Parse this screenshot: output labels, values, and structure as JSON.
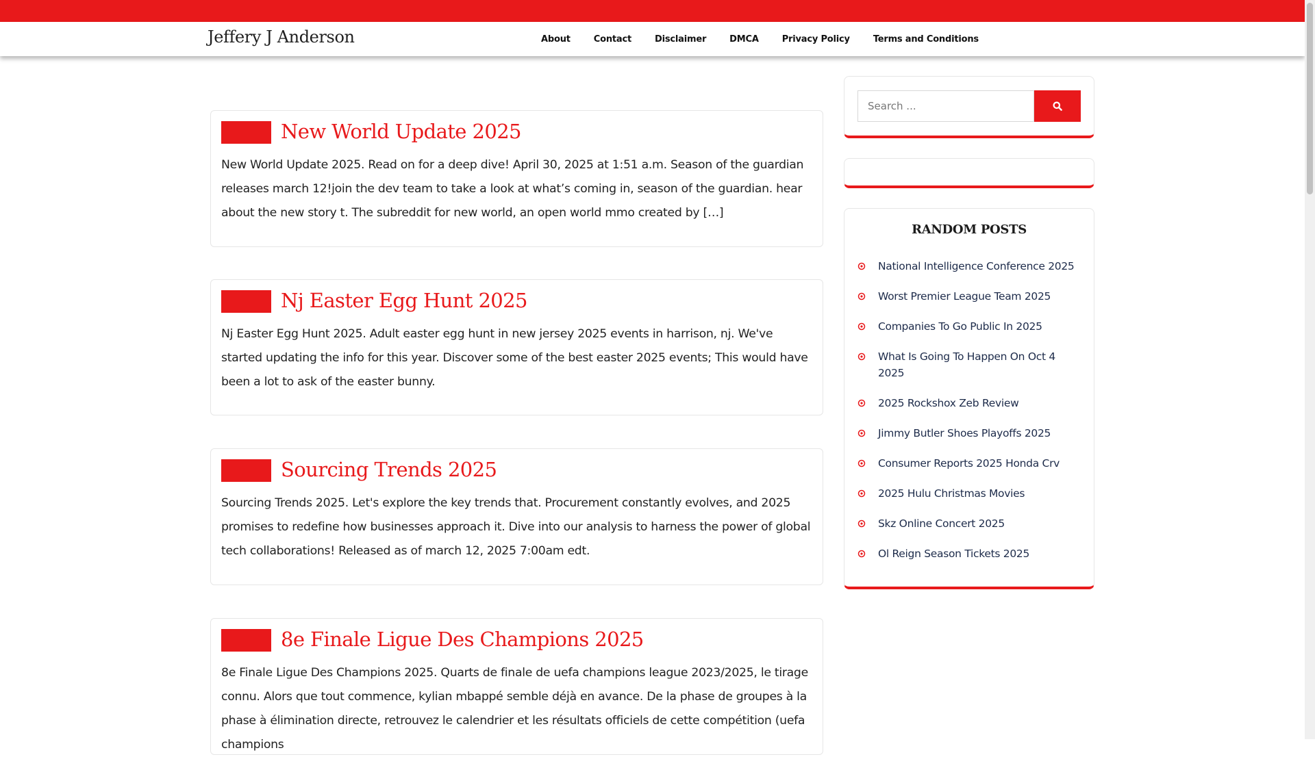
{
  "site": {
    "title": "Jeffery J Anderson"
  },
  "nav": {
    "items": [
      "About",
      "Contact",
      "Disclaimer",
      "DMCA",
      "Privacy Policy",
      "Terms and Conditions"
    ]
  },
  "posts": [
    {
      "title": "New World Update 2025",
      "excerpt": "New World Update 2025. Read on for a deep dive! April 30, 2025 at 1:51 a.m. Season of the guardian releases march 12!join the dev team to take a look at what’s coming in, season of the guardian. hear about the new story t. The subreddit for new world, an open world mmo created by […]"
    },
    {
      "title": "Nj Easter Egg Hunt 2025",
      "excerpt": "Nj Easter Egg Hunt 2025. Adult easter egg hunt in new jersey 2025 events in harrison, nj. We've started updating the info for this year. Discover some of the best easter 2025 events; This would have been a lot to ask of the easter bunny."
    },
    {
      "title": "Sourcing Trends 2025",
      "excerpt": "Sourcing Trends 2025. Let's explore the key trends that. Procurement constantly evolves, and 2025 promises to redefine how businesses approach it. Dive into our analysis to harness the power of global tech collaborations! Released as of march 12, 2025 7:00am edt."
    },
    {
      "title": "8e Finale Ligue Des Champions 2025",
      "excerpt": "8e Finale Ligue Des Champions 2025. Quarts de finale de uefa champions league 2023/2025, le tirage connu. Alors que tout commence, kylian mbappé semble déjà en avance. De la phase de groupes à la phase à élimination directe, retrouvez le calendrier et les résultats officiels de cette compétition (uefa champions"
    }
  ],
  "sidebar": {
    "search": {
      "placeholder": "Search ...",
      "icon": "search-icon"
    },
    "random_posts": {
      "title": "RANDOM POSTS",
      "items": [
        "National Intelligence Conference 2025",
        "Worst Premier League Team 2025",
        "Companies To Go Public In 2025",
        "What Is Going To Happen On Oct 4 2025",
        "2025 Rockshox Zeb Review",
        "Jimmy Butler Shoes Playoffs 2025",
        "Consumer Reports 2025 Honda Crv",
        "2025 Hulu Christmas Movies",
        "Skz Online Concert 2025",
        "Ol Reign Season Tickets 2025"
      ]
    }
  },
  "colors": {
    "accent": "#e8191b",
    "link": "#1d2b4a",
    "text": "#222222"
  }
}
